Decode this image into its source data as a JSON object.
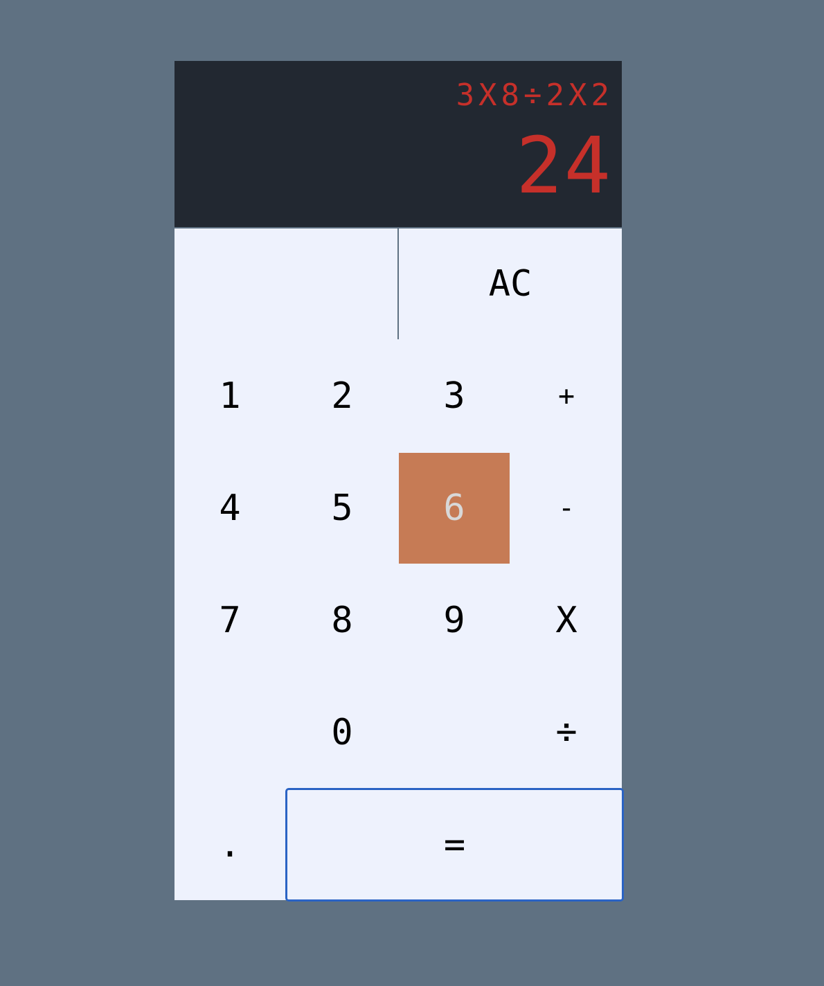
{
  "display": {
    "expression": "3X8÷2X2",
    "result": "24"
  },
  "keys": {
    "blank_top": "",
    "ac": "AC",
    "one": "1",
    "two": "2",
    "three": "3",
    "plus": "+",
    "four": "4",
    "five": "5",
    "six": "6",
    "minus": "-",
    "seven": "7",
    "eight": "8",
    "nine": "9",
    "multiply": "X",
    "blank_left": "",
    "zero": "0",
    "blank_mid": "",
    "divide": "÷",
    "decimal": ".",
    "equals": "="
  },
  "colors": {
    "page_background": "#5f7182",
    "display_background": "#222831",
    "display_text": "#c6302a",
    "key_background": "#eef2fd",
    "key_pressed": "#c67b55",
    "focus_outline": "#2a63c4"
  }
}
